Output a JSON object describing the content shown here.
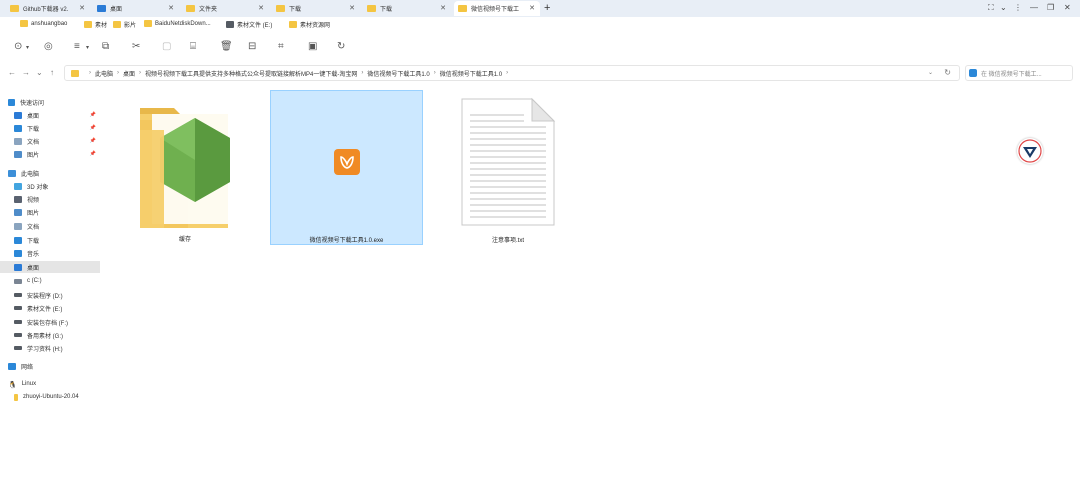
{
  "tabs": [
    {
      "label": "Github下载器 v2.",
      "icon": "folder-icon",
      "active": false
    },
    {
      "label": "桌面",
      "icon": "desktop-icon",
      "active": false
    },
    {
      "label": "文件夹",
      "icon": "folder-icon",
      "active": false
    },
    {
      "label": "下载",
      "icon": "folder-icon",
      "active": false
    },
    {
      "label": "下载",
      "icon": "folder-icon",
      "active": false
    },
    {
      "label": "微信视频号下载工",
      "icon": "folder-icon",
      "active": true
    }
  ],
  "bookmarks": [
    {
      "label": "anshuangbao"
    },
    {
      "label": "素材"
    },
    {
      "label": "影片"
    },
    {
      "label": "BaiduNetdiskDown..."
    },
    {
      "label": "素材文件 (E:)"
    },
    {
      "label": "素材资源网"
    }
  ],
  "breadcrumb": [
    {
      "label": "此电脑"
    },
    {
      "label": "桌面"
    },
    {
      "label": "视频号视频下载工具提供支持多种格式公众号提取链接解析MP4一键下载-淘宝网"
    },
    {
      "label": "微信视频号下载工具1.0"
    },
    {
      "label": "微信视频号下载工具1.0"
    }
  ],
  "search": {
    "placeholder": "在 微信视频号下载工..."
  },
  "sidebar": [
    {
      "label": "快速访问",
      "icon": "star-icon",
      "color": "#2b88d8",
      "pinned": false,
      "selected": false
    },
    {
      "label": "桌面",
      "icon": "desktop-icon",
      "color": "#2b7bd6",
      "pinned": true,
      "selected": false
    },
    {
      "label": "下载",
      "icon": "download-icon",
      "color": "#2b88d8",
      "pinned": true,
      "selected": false
    },
    {
      "label": "文档",
      "icon": "document-icon",
      "color": "#8aa4bf",
      "pinned": true,
      "selected": false
    },
    {
      "label": "图片",
      "icon": "picture-icon",
      "color": "#4f8cc9",
      "pinned": true,
      "selected": false
    },
    {
      "label": "此电脑",
      "icon": "computer-icon",
      "color": "#3c8fd8",
      "pinned": false,
      "selected": false
    },
    {
      "label": "3D 对象",
      "icon": "3d-objects-icon",
      "color": "#43a5e0",
      "pinned": false,
      "selected": false
    },
    {
      "label": "视频",
      "icon": "video-icon",
      "color": "#5a6270",
      "pinned": false,
      "selected": false
    },
    {
      "label": "图片",
      "icon": "picture-icon",
      "color": "#4f8cc9",
      "pinned": false,
      "selected": false
    },
    {
      "label": "文档",
      "icon": "document-icon",
      "color": "#8aa4bf",
      "pinned": false,
      "selected": false
    },
    {
      "label": "下载",
      "icon": "download-icon",
      "color": "#2b88d8",
      "pinned": false,
      "selected": false
    },
    {
      "label": "音乐",
      "icon": "music-icon",
      "color": "#2b88d8",
      "pinned": false,
      "selected": false
    },
    {
      "label": "桌面",
      "icon": "desktop-icon",
      "color": "#2b7bd6",
      "pinned": false,
      "selected": true
    },
    {
      "label": "c (C:)",
      "icon": "drive-icon",
      "color": "#7a8593",
      "pinned": false,
      "selected": false
    },
    {
      "label": "安装程序 (D:)",
      "icon": "drive-icon",
      "color": "#555b63",
      "pinned": false,
      "selected": false
    },
    {
      "label": "素材文件 (E:)",
      "icon": "drive-icon",
      "color": "#555b63",
      "pinned": false,
      "selected": false
    },
    {
      "label": "安装包存档 (F:)",
      "icon": "drive-icon",
      "color": "#555b63",
      "pinned": false,
      "selected": false
    },
    {
      "label": "备用素材 (G:)",
      "icon": "drive-icon",
      "color": "#555b63",
      "pinned": false,
      "selected": false
    },
    {
      "label": "学习资料 (H:)",
      "icon": "drive-icon",
      "color": "#555b63",
      "pinned": false,
      "selected": false
    },
    {
      "label": "网络",
      "icon": "network-icon",
      "color": "#2b88d8",
      "pinned": false,
      "selected": false
    },
    {
      "label": "Linux",
      "icon": "linux-icon",
      "color": "#333333",
      "pinned": false,
      "selected": false
    },
    {
      "label": "zhuoyi-Ubuntu-20.04",
      "icon": "folder-icon",
      "color": "#f4c542",
      "pinned": false,
      "selected": false
    }
  ],
  "files": [
    {
      "name": "缓存",
      "type": "folder",
      "selected": false
    },
    {
      "name": "微信视频号下载工具1.0.exe",
      "type": "exe",
      "selected": true
    },
    {
      "name": "注意事项.txt",
      "type": "txt",
      "selected": false
    }
  ],
  "colors": {
    "selection_bg": "#cce8ff",
    "selection_border": "#99d1ff",
    "folder": "#f4c542",
    "accent": "#2b88d8",
    "app_orange": "#f08a24"
  }
}
